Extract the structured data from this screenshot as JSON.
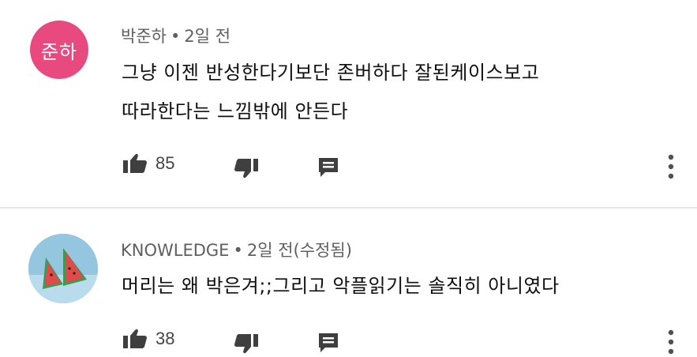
{
  "comments": [
    {
      "avatar_text": "준하",
      "avatar_color": "#e84a80",
      "author": "박준하",
      "separator": "•",
      "time": "2일 전",
      "lines": [
        "그냥 이젠 반성한다기보단 존버하다 잘된케이스보고",
        "따라한다는 느낌밖에 안든다"
      ],
      "likes": "85",
      "actions": {
        "like_icon": "thumbs-up-icon",
        "dislike_icon": "thumbs-down-icon",
        "reply_icon": "reply-icon",
        "more_icon": "more-vert-icon"
      }
    },
    {
      "avatar_color": "#8fc0dd",
      "avatar_image": "watermelon-illustration",
      "author": "KNOWLEDGE",
      "separator": "•",
      "time": "2일 전(수정됨)",
      "lines": [
        "머리는 왜 박은겨;;그리고 악플읽기는 솔직히 아니였다"
      ],
      "likes": "38",
      "actions": {
        "like_icon": "thumbs-up-icon",
        "dislike_icon": "thumbs-down-icon",
        "reply_icon": "reply-icon",
        "more_icon": "more-vert-icon"
      }
    }
  ]
}
